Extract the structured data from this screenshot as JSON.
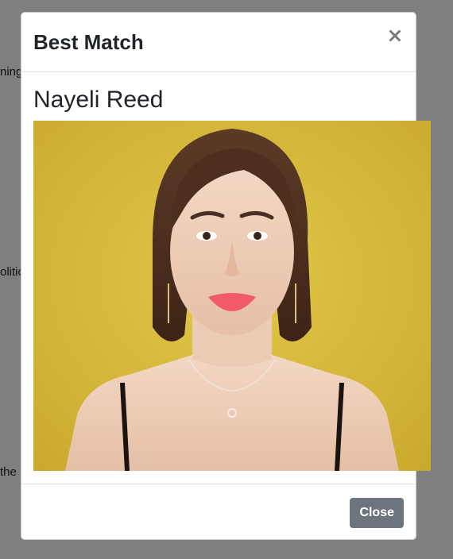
{
  "background": {
    "fragments": [
      "ning",
      "olitic",
      "the"
    ]
  },
  "modal": {
    "title": "Best Match",
    "close_icon": "close-icon",
    "body": {
      "name": "Nayeli Reed",
      "photo_description": ""
    },
    "footer": {
      "close_label": "Close"
    }
  },
  "colors": {
    "backdrop": "#808080",
    "close_button_bg": "#6c757d",
    "photo_background": "#d4b83a"
  }
}
